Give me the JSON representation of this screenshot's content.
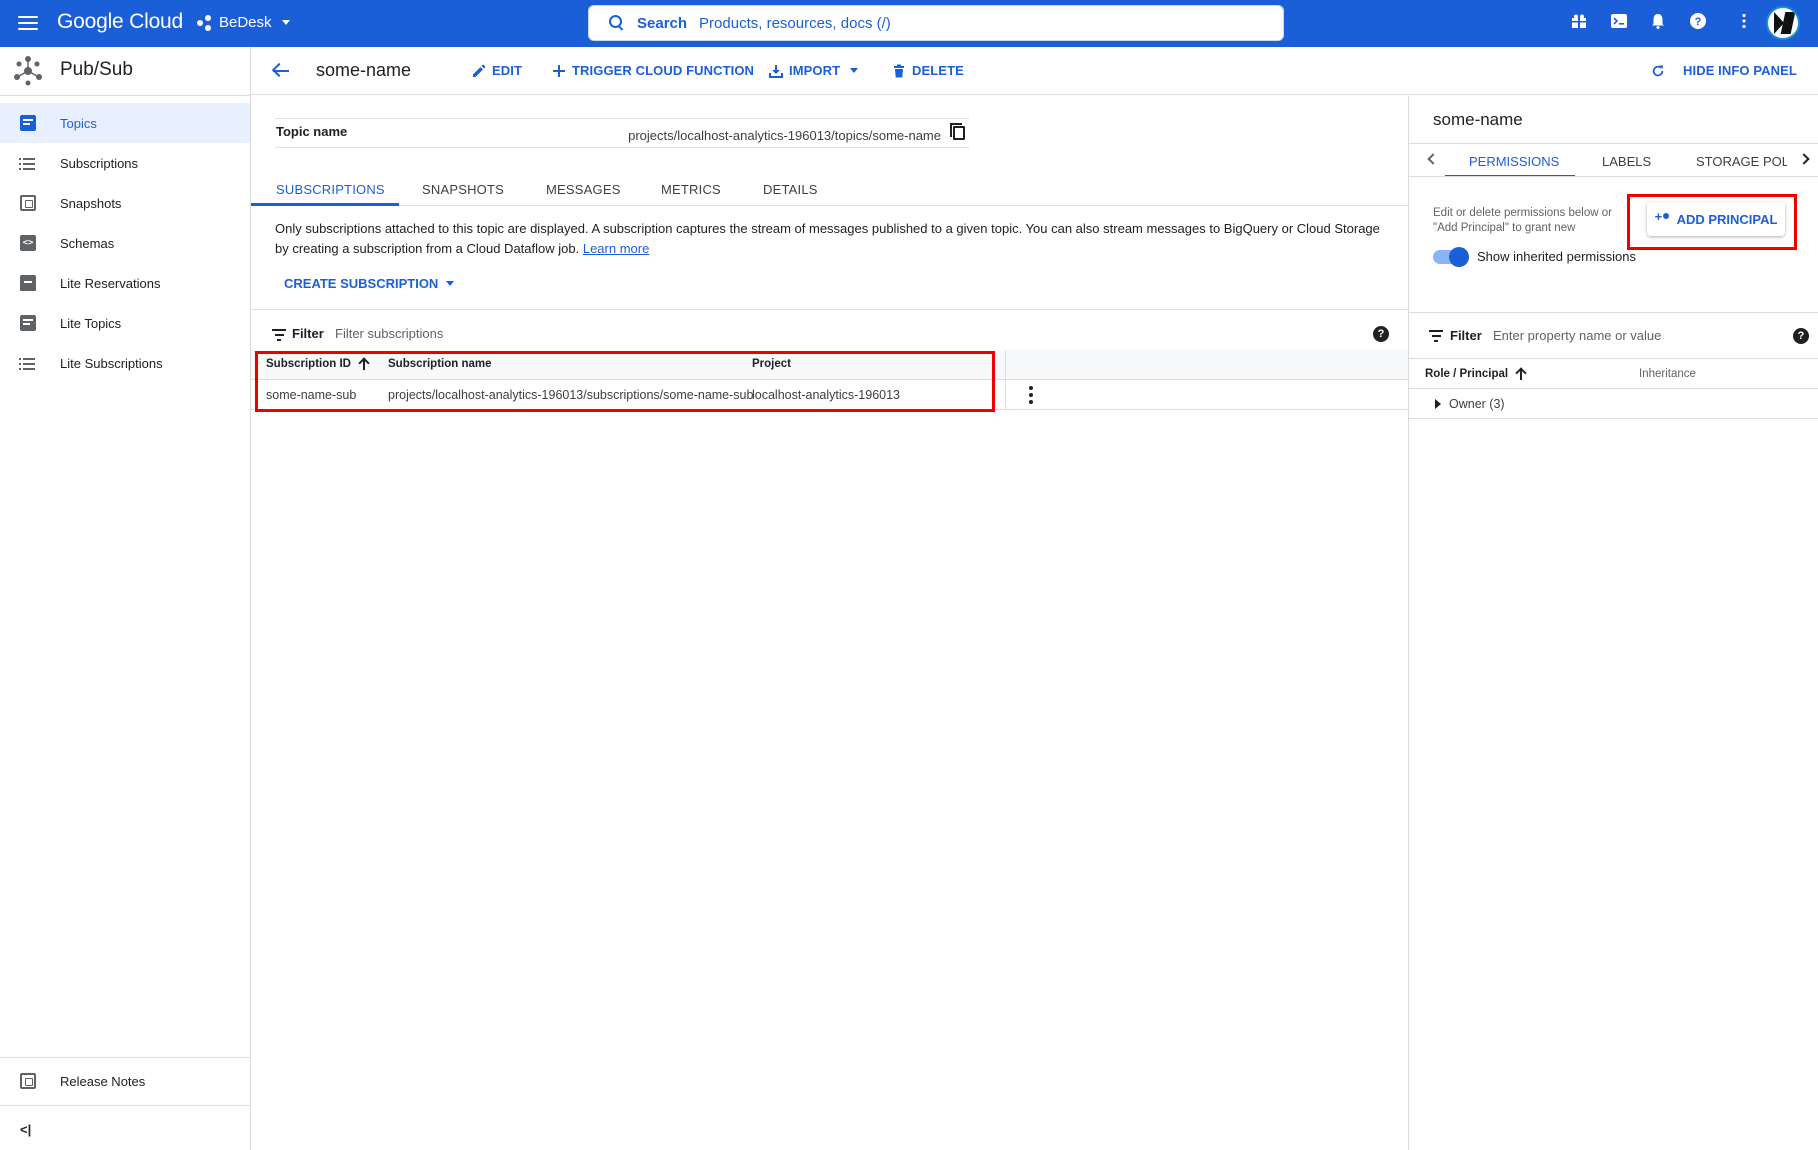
{
  "topbar": {
    "logo": "Google Cloud",
    "project": "BeDesk",
    "search_label": "Search",
    "search_placeholder": "Products, resources, docs (/)",
    "brand_color": "#1b5fd8"
  },
  "product": {
    "name": "Pub/Sub"
  },
  "sidebar": {
    "items": [
      {
        "label": "Topics",
        "icon": "topics-icon",
        "active": true
      },
      {
        "label": "Subscriptions",
        "icon": "list-icon"
      },
      {
        "label": "Snapshots",
        "icon": "snapshot-icon"
      },
      {
        "label": "Schemas",
        "icon": "schema-icon"
      },
      {
        "label": "Lite Reservations",
        "icon": "reservation-icon"
      },
      {
        "label": "Lite Topics",
        "icon": "topics-icon"
      },
      {
        "label": "Lite Subscriptions",
        "icon": "list-icon"
      }
    ],
    "release_notes": "Release Notes",
    "collapse": "<|"
  },
  "actionbar": {
    "title": "some-name",
    "edit": "EDIT",
    "trigger": "TRIGGER CLOUD FUNCTION",
    "import": "IMPORT",
    "delete": "DELETE",
    "hide_panel": "HIDE INFO PANEL"
  },
  "topic": {
    "label": "Topic name",
    "value": "projects/localhost-analytics-196013/topics/some-name"
  },
  "tabs": [
    "SUBSCRIPTIONS",
    "SNAPSHOTS",
    "MESSAGES",
    "METRICS",
    "DETAILS"
  ],
  "description": {
    "text": "Only subscriptions attached to this topic are displayed. A subscription captures the stream of messages published to a given topic. You can also stream messages to BigQuery or Cloud Storage by creating a subscription from a Cloud Dataflow job.",
    "link": "Learn more"
  },
  "create_subscription": "CREATE SUBSCRIPTION",
  "filter": {
    "label": "Filter",
    "placeholder": "Filter subscriptions"
  },
  "table": {
    "columns": [
      "Subscription ID",
      "Subscription name",
      "Project"
    ],
    "rows": [
      {
        "id": "some-name-sub",
        "name": "projects/localhost-analytics-196013/subscriptions/some-name-sub",
        "project": "localhost-analytics-196013"
      }
    ]
  },
  "info_panel": {
    "title": "some-name",
    "tabs": [
      "PERMISSIONS",
      "LABELS",
      "STORAGE POLI"
    ],
    "perm_text": "Edit or delete permissions below or \"Add Principal\" to grant new",
    "add_principal": "ADD PRINCIPAL",
    "show_inherited": "Show inherited permissions",
    "filter_label": "Filter",
    "filter_placeholder": "Enter property name or value",
    "columns": [
      "Role / Principal",
      "Inheritance"
    ],
    "rows": [
      {
        "label": "Owner (3)"
      }
    ]
  }
}
